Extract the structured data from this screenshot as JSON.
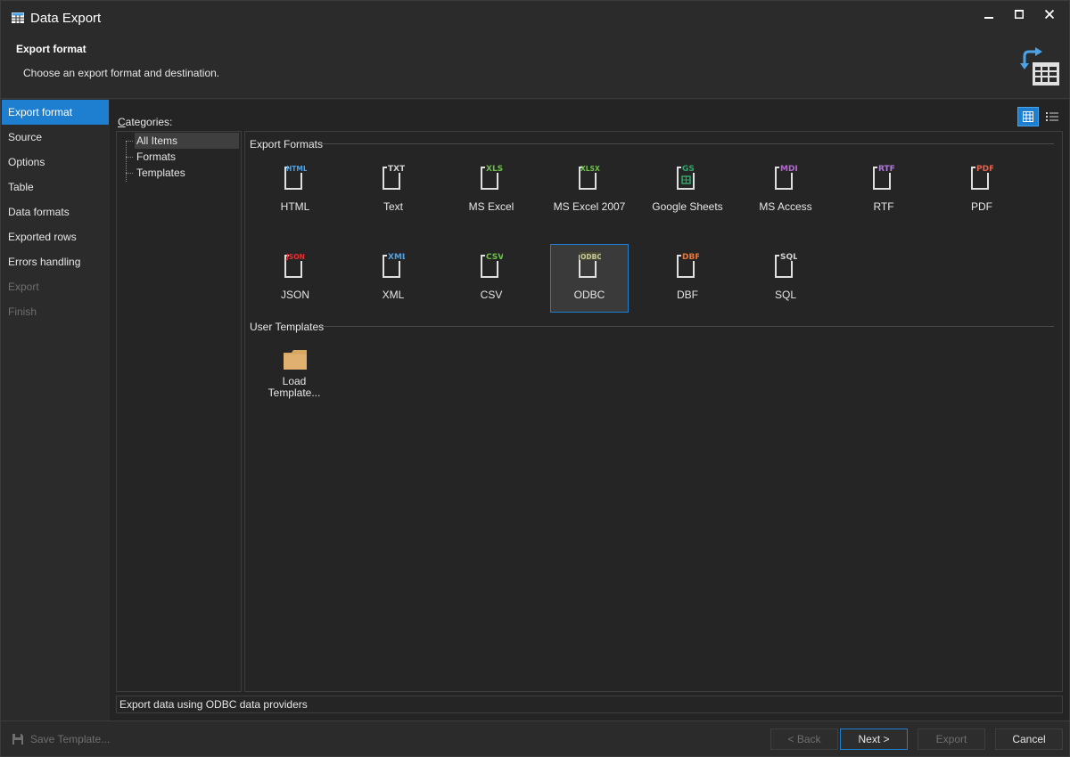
{
  "window": {
    "title": "Data Export"
  },
  "header": {
    "title": "Export format",
    "subtitle": "Choose an export format and destination."
  },
  "nav": {
    "items": [
      {
        "label": "Export format",
        "state": "active"
      },
      {
        "label": "Source",
        "state": "normal"
      },
      {
        "label": "Options",
        "state": "normal"
      },
      {
        "label": "Table",
        "state": "normal"
      },
      {
        "label": "Data formats",
        "state": "normal"
      },
      {
        "label": "Exported rows",
        "state": "normal"
      },
      {
        "label": "Errors handling",
        "state": "normal"
      },
      {
        "label": "Export",
        "state": "disabled"
      },
      {
        "label": "Finish",
        "state": "disabled"
      }
    ]
  },
  "categories": {
    "label_first": "C",
    "label_rest": "ategories:",
    "items": [
      "All Items",
      "Formats",
      "Templates"
    ],
    "selected": "All Items"
  },
  "groups": {
    "export_formats": "Export Formats",
    "user_templates": "User Templates"
  },
  "formats": [
    {
      "label": "HTML",
      "tag": "HTML",
      "color": "#4aa3e8"
    },
    {
      "label": "Text",
      "tag": "TXT",
      "color": "#d0d0d0"
    },
    {
      "label": "MS Excel",
      "tag": "XLS",
      "color": "#6cc04a"
    },
    {
      "label": "MS Excel 2007",
      "tag": "XLSX",
      "color": "#6cc04a"
    },
    {
      "label": "Google Sheets",
      "tag": "GS",
      "color": "#2fa86a"
    },
    {
      "label": "MS Access",
      "tag": "MDB",
      "color": "#b06ac8"
    },
    {
      "label": "RTF",
      "tag": "RTF",
      "color": "#b07ad8"
    },
    {
      "label": "PDF",
      "tag": "PDF",
      "color": "#e8604a"
    },
    {
      "label": "JSON",
      "tag": "JSON",
      "color": "#e83030"
    },
    {
      "label": "XML",
      "tag": "XML",
      "color": "#4aa3e8"
    },
    {
      "label": "CSV",
      "tag": "CSV",
      "color": "#6cc04a"
    },
    {
      "label": "ODBC",
      "tag": "ODBC",
      "color": "#c8c8a0"
    },
    {
      "label": "DBF",
      "tag": "DBF",
      "color": "#e8783a"
    },
    {
      "label": "SQL",
      "tag": "SQL",
      "color": "#d0d0d0"
    }
  ],
  "selected_format": "ODBC",
  "template": {
    "line1": "Load",
    "line2": "Template..."
  },
  "status": "Export data using ODBC data providers",
  "footer": {
    "save_template": "Save Template...",
    "back": "< Back",
    "next": "Next >",
    "export": "Export",
    "cancel": "Cancel"
  },
  "colors": {
    "accent": "#1e7fd0",
    "folder": "#d8a862"
  },
  "icons": {
    "app": "table-export-icon",
    "header": "table-export-icon",
    "view_large": "large-icons-view-icon",
    "view_list": "list-view-icon",
    "save": "floppy-disk-icon"
  }
}
